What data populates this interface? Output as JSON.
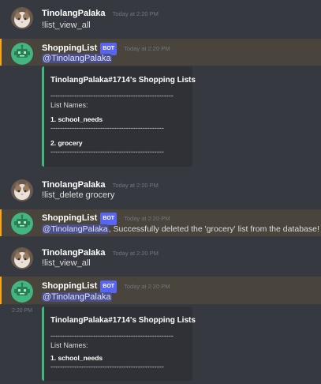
{
  "user": {
    "name": "TinolangPalaka"
  },
  "bot": {
    "name": "ShoppingList",
    "badge": "BOT"
  },
  "timestamp": "Today at 2:20 PM",
  "side_time": "2:20 PM",
  "mention": "@TinolangPalaka",
  "messages": {
    "m1": {
      "text": "!list_view_all"
    },
    "m2": {
      "embed": {
        "title": "TinolangPalaka#1714's Shopping Lists",
        "divider_long": "----------------------------------------------------",
        "list_names": "List Names:",
        "item1": "1. school_needs",
        "divider_short": "------------------------------------------------",
        "item2": "2. grocery",
        "divider_end": "------------------------------------------------"
      }
    },
    "m3": {
      "text": "!list_delete grocery"
    },
    "m4": {
      "text": ", Successfully deleted the 'grocery' list from the database!"
    },
    "m5": {
      "text": "!list_view_all"
    },
    "m6": {
      "embed": {
        "title": "TinolangPalaka#1714's Shopping Lists",
        "divider_long": "----------------------------------------------------",
        "list_names": "List Names:",
        "item1": "1. school_needs",
        "divider_short": "------------------------------------------------"
      }
    }
  },
  "colors": {
    "background": "#36393f",
    "mention_highlight": "#49443c",
    "mention_bar": "#faa61a",
    "embed_bg": "#2f3136",
    "embed_accent": "#43b581",
    "bot_badge": "#5865f2"
  }
}
